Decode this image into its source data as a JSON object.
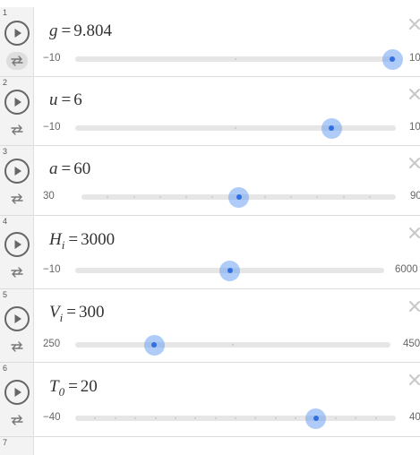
{
  "sliders": [
    {
      "row_number": "1",
      "variable": "g",
      "subscript": "",
      "value_text": "9.804",
      "value": 9.804,
      "min": -10,
      "max": 10,
      "min_label": "−10",
      "max_label": "10",
      "repeat_active": true
    },
    {
      "row_number": "2",
      "variable": "u",
      "subscript": "",
      "value_text": "6",
      "value": 6,
      "min": -10,
      "max": 10,
      "min_label": "−10",
      "max_label": "10",
      "repeat_active": false
    },
    {
      "row_number": "3",
      "variable": "a",
      "subscript": "",
      "value_text": "60",
      "value": 60,
      "min": 30,
      "max": 90,
      "min_label": "30",
      "max_label": "90",
      "repeat_active": false
    },
    {
      "row_number": "4",
      "variable": "H",
      "subscript": "i",
      "value_text": "3000",
      "value": 3000,
      "min": -10,
      "max": 6000,
      "min_label": "−10",
      "max_label": "6000",
      "repeat_active": false
    },
    {
      "row_number": "5",
      "variable": "V",
      "subscript": "i",
      "value_text": "300",
      "value": 300,
      "min": 250,
      "max": 450,
      "min_label": "250",
      "max_label": "450",
      "repeat_active": false
    },
    {
      "row_number": "6",
      "variable": "T",
      "subscript": "0",
      "value_text": "20",
      "value": 20,
      "min": -40,
      "max": 40,
      "min_label": "−40",
      "max_label": "40",
      "repeat_active": false
    }
  ],
  "next_row_number": "7",
  "icons": {
    "play": "play-icon",
    "repeat": "repeat-icon",
    "delete": "close-icon"
  },
  "colors": {
    "thumb_dot": "#2f6fe0",
    "thumb_halo": "#8fb4f0",
    "track": "#e6e6e6",
    "gutter": "#f3f3f3"
  }
}
